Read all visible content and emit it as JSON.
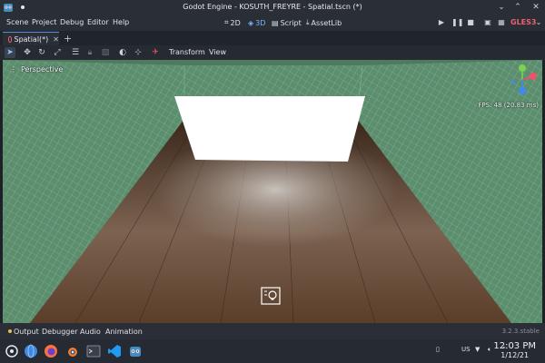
{
  "window": {
    "title": "Godot Engine - KOSUTH_FREYRE - Spatial.tscn (*)",
    "icons": [
      "godot-app-icon",
      "pin-dot-icon",
      "minimize-icon",
      "maximize-icon",
      "close-icon"
    ]
  },
  "menubar": {
    "menus": [
      "Scene",
      "Project",
      "Debug",
      "Editor",
      "Help"
    ],
    "main_screens": [
      {
        "label": "2D",
        "icon": "2d-icon",
        "active": false
      },
      {
        "label": "3D",
        "icon": "3d-icon",
        "active": true
      },
      {
        "label": "Script",
        "icon": "script-icon",
        "active": false
      },
      {
        "label": "AssetLib",
        "icon": "assetlib-icon",
        "active": false
      }
    ],
    "playback_icons": [
      "play-icon",
      "pause-icon",
      "stop-icon",
      "play-scene-icon",
      "play-custom-icon"
    ],
    "renderer": "GLES3",
    "renderer_color": "#f06070"
  },
  "scene_tabs": {
    "tabs": [
      {
        "label": "Spatial(*)",
        "icon": "spatial-node-icon"
      }
    ],
    "add_icon": "plus-icon"
  },
  "toolbar": {
    "tools": [
      "select-icon",
      "move-icon",
      "rotate-icon",
      "scale-icon",
      "list-icon",
      "lock-icon",
      "group-icon",
      "local-space-icon",
      "snap-icon",
      "camera-override-icon"
    ],
    "menus": [
      "Transform",
      "View"
    ]
  },
  "viewport": {
    "mode_label": "Perspective",
    "fps_text": "FPS: 48 (20.83 ms)",
    "gizmo_axes": {
      "y": "#7bd44f",
      "x": "#f0506a",
      "z": "#3d8af0"
    },
    "colors": {
      "grid_wall": "#5c8d6e",
      "floor": "#6a4a32",
      "backdrop": "#ffffff"
    }
  },
  "bottom_panel": {
    "tabs": [
      "Output",
      "Debugger",
      "Audio",
      "Animation"
    ],
    "version": "3.2.3.stable"
  },
  "taskbar": {
    "apps": [
      "application-launcher-icon",
      "globe-icon",
      "firefox-icon",
      "blender-icon",
      "terminal-icon",
      "vscode-icon",
      "godot-icon"
    ],
    "tray_icons": [
      "clipboard-icon",
      "keyboard-layout",
      "network-icon",
      "volume-icon",
      "expand-tray-icon"
    ],
    "keyboard_layout": "US",
    "time": "12:03 PM",
    "date": "1/12/21"
  }
}
